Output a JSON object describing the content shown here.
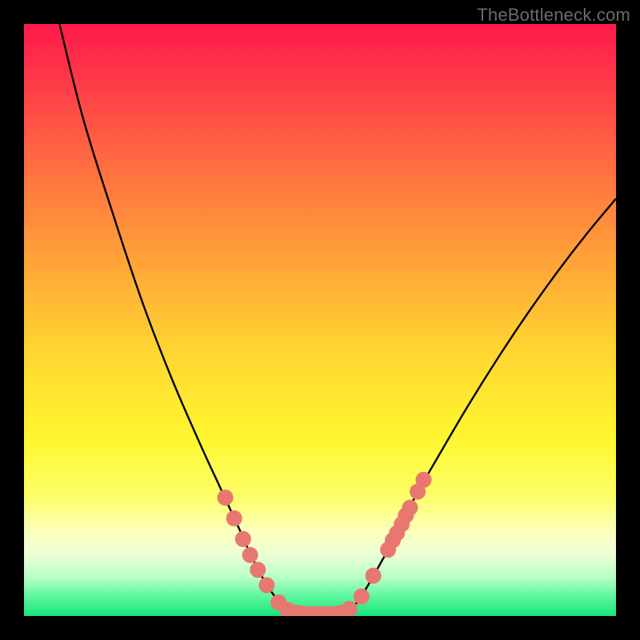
{
  "watermark": "TheBottleneck.com",
  "colors": {
    "frame": "#000000",
    "curve_stroke": "#000000",
    "marker_fill": "#e8786f",
    "marker_stroke": "#e8786f"
  },
  "gradient_stops": [
    {
      "offset": 0.0,
      "color": "#ff1a4b"
    },
    {
      "offset": 0.1,
      "color": "#ff3b49"
    },
    {
      "offset": 0.25,
      "color": "#ff7140"
    },
    {
      "offset": 0.4,
      "color": "#ffa338"
    },
    {
      "offset": 0.55,
      "color": "#ffd531"
    },
    {
      "offset": 0.7,
      "color": "#fff62f"
    },
    {
      "offset": 0.8,
      "color": "#fbff69"
    },
    {
      "offset": 0.86,
      "color": "#fdffc0"
    },
    {
      "offset": 0.9,
      "color": "#e8ffd5"
    },
    {
      "offset": 0.935,
      "color": "#b6ffc6"
    },
    {
      "offset": 0.965,
      "color": "#63f7a0"
    },
    {
      "offset": 1.0,
      "color": "#18e37c"
    }
  ],
  "chart_data": {
    "type": "line",
    "title": "",
    "xlabel": "",
    "ylabel": "",
    "xlim": [
      0,
      100
    ],
    "ylim": [
      0,
      100
    ],
    "series": [
      {
        "name": "bottleneck-curve",
        "points": [
          {
            "x": 6.0,
            "y": 100.0
          },
          {
            "x": 10.0,
            "y": 84.0
          },
          {
            "x": 15.0,
            "y": 68.0
          },
          {
            "x": 20.0,
            "y": 53.0
          },
          {
            "x": 25.0,
            "y": 40.0
          },
          {
            "x": 30.0,
            "y": 28.5
          },
          {
            "x": 33.0,
            "y": 22.0
          },
          {
            "x": 36.0,
            "y": 15.5
          },
          {
            "x": 38.0,
            "y": 11.0
          },
          {
            "x": 40.0,
            "y": 7.0
          },
          {
            "x": 42.0,
            "y": 3.8
          },
          {
            "x": 44.0,
            "y": 1.6
          },
          {
            "x": 46.0,
            "y": 0.6
          },
          {
            "x": 48.0,
            "y": 0.3
          },
          {
            "x": 50.0,
            "y": 0.3
          },
          {
            "x": 52.0,
            "y": 0.3
          },
          {
            "x": 54.0,
            "y": 0.6
          },
          {
            "x": 56.0,
            "y": 2.0
          },
          {
            "x": 58.0,
            "y": 5.0
          },
          {
            "x": 60.0,
            "y": 8.5
          },
          {
            "x": 63.0,
            "y": 14.0
          },
          {
            "x": 66.0,
            "y": 20.0
          },
          {
            "x": 70.0,
            "y": 27.0
          },
          {
            "x": 75.0,
            "y": 35.5
          },
          {
            "x": 80.0,
            "y": 43.5
          },
          {
            "x": 85.0,
            "y": 51.0
          },
          {
            "x": 90.0,
            "y": 58.0
          },
          {
            "x": 95.0,
            "y": 64.5
          },
          {
            "x": 100.0,
            "y": 70.5
          }
        ]
      }
    ],
    "markers": [
      {
        "x": 34.0,
        "y": 20.0
      },
      {
        "x": 35.5,
        "y": 16.5
      },
      {
        "x": 37.0,
        "y": 13.0
      },
      {
        "x": 38.2,
        "y": 10.3
      },
      {
        "x": 39.5,
        "y": 7.8
      },
      {
        "x": 41.0,
        "y": 5.2
      },
      {
        "x": 43.0,
        "y": 2.3
      },
      {
        "x": 44.5,
        "y": 1.0
      },
      {
        "x": 46.0,
        "y": 0.55
      },
      {
        "x": 47.0,
        "y": 0.4
      },
      {
        "x": 48.0,
        "y": 0.3
      },
      {
        "x": 49.0,
        "y": 0.3
      },
      {
        "x": 50.0,
        "y": 0.3
      },
      {
        "x": 51.0,
        "y": 0.3
      },
      {
        "x": 52.0,
        "y": 0.3
      },
      {
        "x": 53.0,
        "y": 0.4
      },
      {
        "x": 54.0,
        "y": 0.6
      },
      {
        "x": 55.0,
        "y": 1.2
      },
      {
        "x": 57.0,
        "y": 3.3
      },
      {
        "x": 59.0,
        "y": 6.8
      },
      {
        "x": 61.5,
        "y": 11.2
      },
      {
        "x": 62.3,
        "y": 12.8
      },
      {
        "x": 63.0,
        "y": 14.0
      },
      {
        "x": 63.8,
        "y": 15.5
      },
      {
        "x": 64.5,
        "y": 17.0
      },
      {
        "x": 65.2,
        "y": 18.3
      },
      {
        "x": 66.5,
        "y": 21.0
      },
      {
        "x": 67.5,
        "y": 23.0
      }
    ]
  }
}
